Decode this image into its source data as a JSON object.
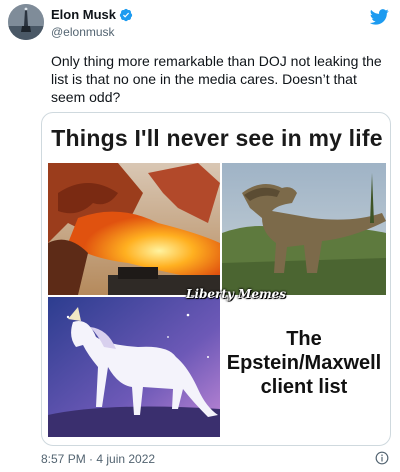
{
  "author": {
    "display_name": "Elon Musk",
    "handle": "@elonmusk",
    "verified_icon": "verified-badge-icon",
    "avatar_icon": "avatar"
  },
  "brand": {
    "logo_icon": "twitter-bird-icon",
    "accent_color": "#1d9bf0"
  },
  "tweet": {
    "text": "Only thing more remarkable than DOJ not leaking the list is that no one in the media cares. Doesn’t that seem odd?",
    "timestamp": "8:57 PM · 4 juin 2022",
    "info_icon": "info-icon"
  },
  "media": {
    "meme_title": "Things I'll never see in my life",
    "panels": [
      "dragon",
      "t-rex",
      "unicorn"
    ],
    "client_list_lines": [
      "The",
      "Epstein/Maxwell",
      "client list"
    ],
    "watermark": "Liberty Memes"
  }
}
